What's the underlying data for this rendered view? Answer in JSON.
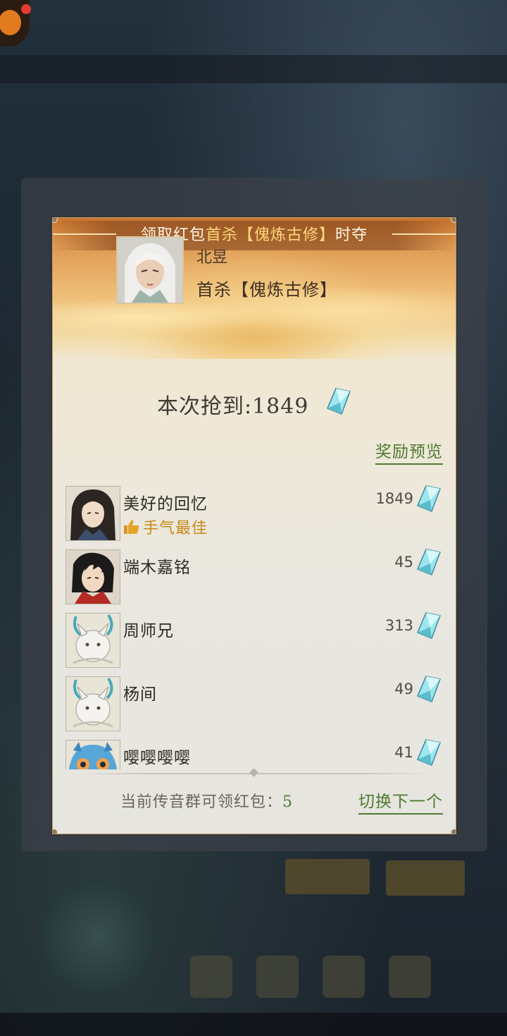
{
  "popup": {
    "title_prefix": "领取红包",
    "title_highlight": "首杀【傀炼古修】",
    "title_suffix": "时夺",
    "sender": {
      "name": "北昱",
      "message": "首杀【傀炼古修】"
    },
    "grab": {
      "label": "本次抢到:",
      "amount": "1849",
      "currency_icon": "spirit-crystal-icon"
    },
    "reward_preview_link": "奖励预览",
    "entries": [
      {
        "name": "美好的回忆",
        "amount": "1849",
        "best_luck": "手气最佳",
        "avatar": "male-cultivator-longhair"
      },
      {
        "name": "端木嘉铭",
        "amount": "45",
        "avatar": "male-cultivator-darkhair"
      },
      {
        "name": "周师兄",
        "amount": "313",
        "avatar": "white-fox-spirit"
      },
      {
        "name": "杨间",
        "amount": "49",
        "avatar": "white-fox-spirit"
      },
      {
        "name": "嘤嘤嘤嘤",
        "amount": "41",
        "avatar": "blue-beast-spirit"
      }
    ],
    "footer": {
      "remaining_label": "当前传音群可领红包：",
      "remaining_count": "5",
      "next_link": "切换下一个"
    }
  },
  "colors": {
    "gold_text": "#ffd77a",
    "link_green": "#4f7a2f",
    "best_luck": "#c98a17",
    "crystal": "#7fd6e0"
  }
}
